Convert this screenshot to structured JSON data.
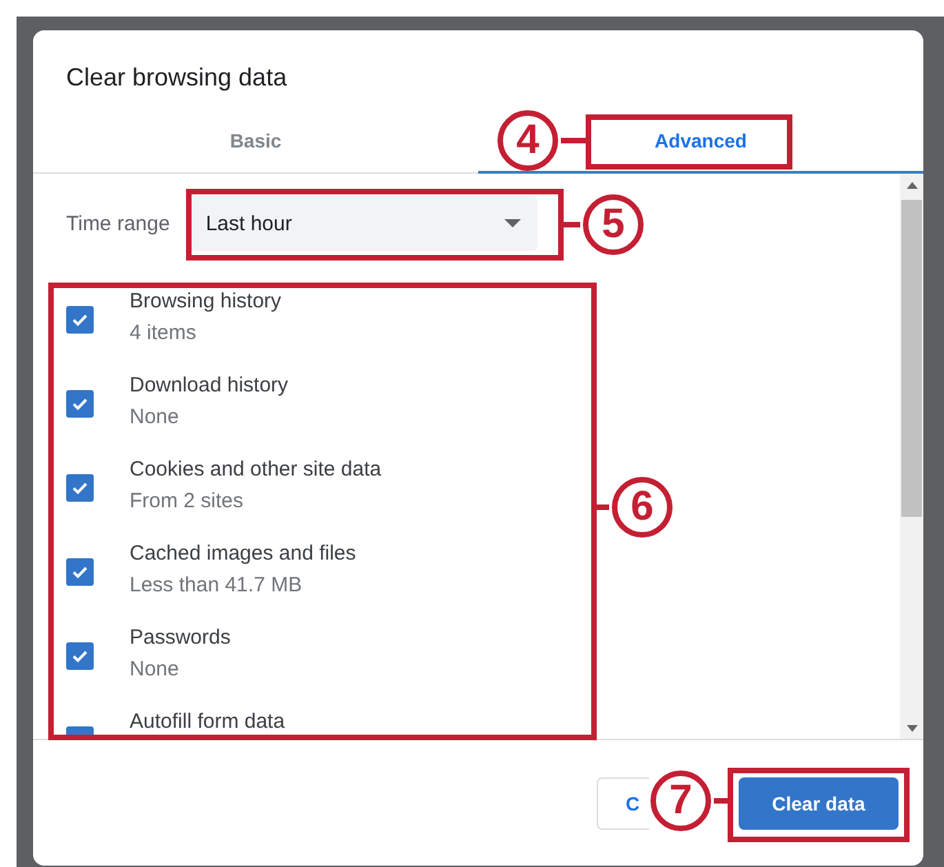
{
  "dialog": {
    "title": "Clear browsing data",
    "tabs": [
      {
        "label": "Basic",
        "selected": false
      },
      {
        "label": "Advanced",
        "selected": true
      }
    ],
    "time_range": {
      "label": "Time range",
      "value": "Last hour"
    },
    "items": [
      {
        "title": "Browsing history",
        "detail": "4 items",
        "checked": true
      },
      {
        "title": "Download history",
        "detail": "None",
        "checked": true
      },
      {
        "title": "Cookies and other site data",
        "detail": "From 2 sites",
        "checked": true
      },
      {
        "title": "Cached images and files",
        "detail": "Less than 41.7 MB",
        "checked": true
      },
      {
        "title": "Passwords",
        "detail": "None",
        "checked": true
      },
      {
        "title": "Autofill form data",
        "checked": true
      }
    ],
    "buttons": [
      {
        "label": "C",
        "kind": "secondary"
      },
      {
        "label": "Clear data",
        "kind": "primary"
      }
    ]
  },
  "annotations": [
    {
      "number": "4"
    },
    {
      "number": "5"
    },
    {
      "number": "6"
    },
    {
      "number": "7"
    }
  ]
}
